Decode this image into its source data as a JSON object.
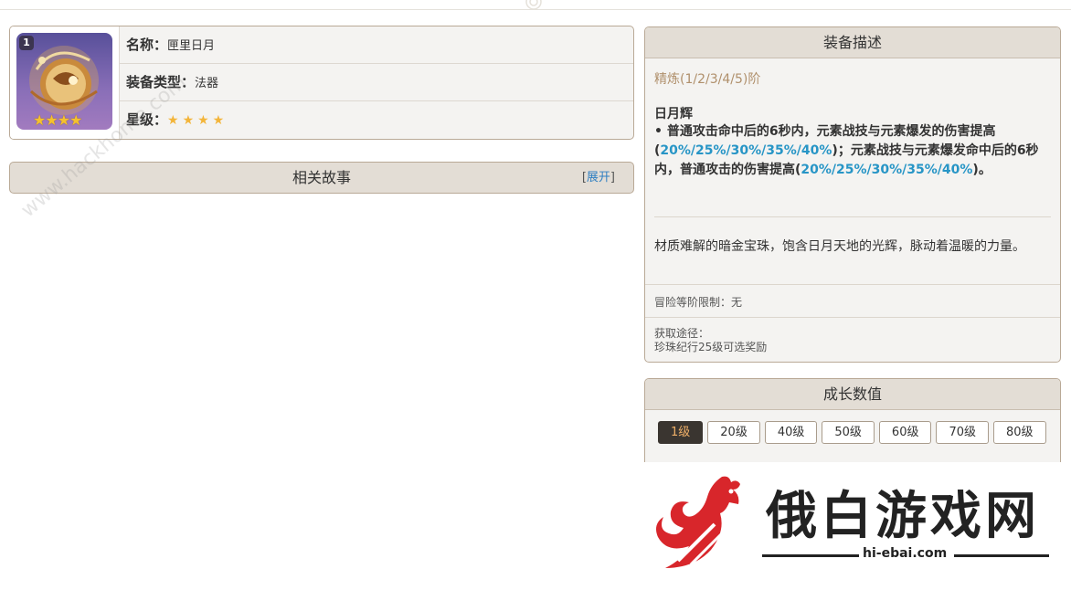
{
  "item": {
    "level_badge": "1",
    "name_label": "名称：",
    "name_value": "匣里日月",
    "type_label": "装备类型：",
    "type_value": "法器",
    "rarity_label": "星级：",
    "rarity_stars": "★★★★",
    "icon_stars": "★★★★",
    "rarity_count": 4
  },
  "story": {
    "title": "相关故事",
    "expand_open": "[",
    "expand_label": "展开",
    "expand_close": "]"
  },
  "description": {
    "header": "装备描述",
    "refine": "精炼(1/2/3/4/5)阶",
    "skill_name": "日月辉",
    "skill_part1": "• 普通攻击命中后的6秒内，元素战技与元素爆发的伤害提高(",
    "skill_hl1": "20%/25%/30%/35%/40%",
    "skill_part2": ")；元素战技与元素爆发命中后的6秒内，普通攻击的伤害提高(",
    "skill_hl2": "20%/25%/30%/35%/40%",
    "skill_part3": ")。",
    "lore": "材质难解的暗金宝珠，饱含日月天地的光辉，脉动着温暖的力量。",
    "rank_limit": "冒险等阶限制：无",
    "obtain_label": "获取途径：",
    "obtain_value": "珍珠纪行25级可选奖励",
    "highlight_color": "#2795c6"
  },
  "growth": {
    "header": "成长数值",
    "levels": [
      "1级",
      "20级",
      "40级",
      "50级",
      "60级",
      "70级",
      "80级"
    ],
    "active_level": "1级"
  },
  "watermark": {
    "text": "www.hackhome.com"
  },
  "logo": {
    "name": "俄白游戏网",
    "url": "hi-ebai.com"
  }
}
